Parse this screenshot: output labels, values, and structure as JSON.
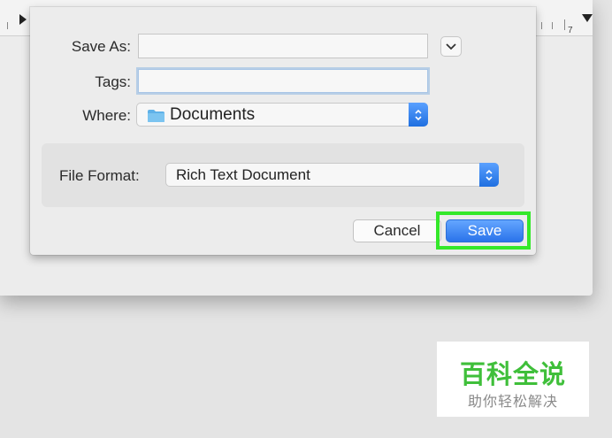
{
  "ruler": {
    "number": "7"
  },
  "dialog": {
    "save_as_label": "Save As:",
    "save_as_value": "",
    "tags_label": "Tags:",
    "tags_value": "",
    "where_label": "Where:",
    "where_value": "Documents",
    "where_icon": "folder-icon",
    "file_format_label": "File Format:",
    "file_format_value": "Rich Text Document",
    "cancel_label": "Cancel",
    "save_label": "Save"
  },
  "watermark": {
    "main": "百科全说",
    "sub": "助你轻松解决"
  },
  "colors": {
    "accent": "#2a73ea",
    "highlight": "#34e82a",
    "watermark": "#3fbf3a"
  }
}
